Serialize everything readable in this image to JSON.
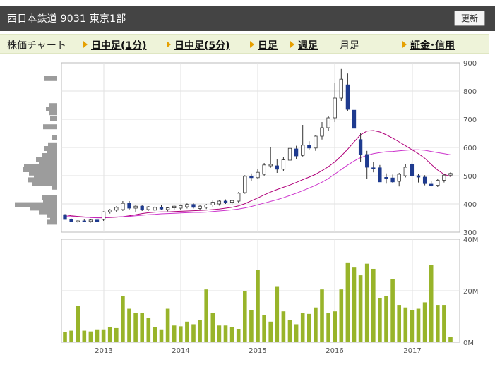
{
  "header": {
    "title": "西日本鉄道  9031  東京1部",
    "refresh_label": "更新"
  },
  "nav": {
    "chart_label": "株価チャート",
    "tabs": [
      {
        "label": "日中足(1分)"
      },
      {
        "label": "日中足(5分)"
      },
      {
        "label": "日足"
      },
      {
        "label": "週足"
      },
      {
        "label": "月足"
      }
    ],
    "margin_label": "証金･信用"
  },
  "chart_data": {
    "type": "candlestick",
    "price_axis": {
      "ticks": [
        300,
        400,
        500,
        600,
        700,
        800,
        900
      ],
      "range": [
        300,
        900
      ]
    },
    "volume_axis": {
      "ticks": [
        "0M",
        "20M",
        "40M"
      ],
      "range": [
        0,
        40
      ]
    },
    "x_labels": [
      "2013",
      "2014",
      "2015",
      "2016",
      "2017"
    ],
    "candle_color_up": "#ffffff",
    "candle_color_down": "#1f3b8f",
    "ma_color": "#b0007a",
    "volume_color": "#98b42a",
    "candles": [
      {
        "o": 362,
        "h": 364,
        "l": 345,
        "c": 345
      },
      {
        "o": 345,
        "h": 348,
        "l": 335,
        "c": 337
      },
      {
        "o": 337,
        "h": 342,
        "l": 334,
        "c": 340
      },
      {
        "o": 340,
        "h": 346,
        "l": 336,
        "c": 338
      },
      {
        "o": 338,
        "h": 345,
        "l": 334,
        "c": 343
      },
      {
        "o": 343,
        "h": 348,
        "l": 336,
        "c": 338
      },
      {
        "o": 345,
        "h": 374,
        "l": 340,
        "c": 372
      },
      {
        "o": 372,
        "h": 382,
        "l": 366,
        "c": 378
      },
      {
        "o": 378,
        "h": 392,
        "l": 372,
        "c": 388
      },
      {
        "o": 380,
        "h": 410,
        "l": 375,
        "c": 402
      },
      {
        "o": 402,
        "h": 410,
        "l": 378,
        "c": 385
      },
      {
        "o": 385,
        "h": 395,
        "l": 372,
        "c": 392
      },
      {
        "o": 392,
        "h": 396,
        "l": 375,
        "c": 380
      },
      {
        "o": 380,
        "h": 392,
        "l": 376,
        "c": 390
      },
      {
        "o": 378,
        "h": 392,
        "l": 374,
        "c": 388
      },
      {
        "o": 388,
        "h": 396,
        "l": 378,
        "c": 382
      },
      {
        "o": 380,
        "h": 390,
        "l": 374,
        "c": 386
      },
      {
        "o": 386,
        "h": 394,
        "l": 380,
        "c": 392
      },
      {
        "o": 385,
        "h": 398,
        "l": 380,
        "c": 394
      },
      {
        "o": 390,
        "h": 402,
        "l": 384,
        "c": 398
      },
      {
        "o": 398,
        "h": 402,
        "l": 384,
        "c": 388
      },
      {
        "o": 384,
        "h": 396,
        "l": 378,
        "c": 392
      },
      {
        "o": 388,
        "h": 400,
        "l": 382,
        "c": 396
      },
      {
        "o": 396,
        "h": 412,
        "l": 390,
        "c": 406
      },
      {
        "o": 400,
        "h": 414,
        "l": 394,
        "c": 410
      },
      {
        "o": 410,
        "h": 416,
        "l": 400,
        "c": 406
      },
      {
        "o": 406,
        "h": 414,
        "l": 398,
        "c": 412
      },
      {
        "o": 410,
        "h": 442,
        "l": 405,
        "c": 438
      },
      {
        "o": 440,
        "h": 502,
        "l": 436,
        "c": 498
      },
      {
        "o": 498,
        "h": 508,
        "l": 480,
        "c": 493
      },
      {
        "o": 493,
        "h": 525,
        "l": 488,
        "c": 512
      },
      {
        "o": 505,
        "h": 545,
        "l": 498,
        "c": 538
      },
      {
        "o": 535,
        "h": 600,
        "l": 528,
        "c": 540
      },
      {
        "o": 535,
        "h": 560,
        "l": 510,
        "c": 523
      },
      {
        "o": 523,
        "h": 565,
        "l": 516,
        "c": 556
      },
      {
        "o": 555,
        "h": 608,
        "l": 545,
        "c": 597
      },
      {
        "o": 595,
        "h": 606,
        "l": 558,
        "c": 570
      },
      {
        "o": 572,
        "h": 680,
        "l": 568,
        "c": 608
      },
      {
        "o": 608,
        "h": 622,
        "l": 592,
        "c": 598
      },
      {
        "o": 598,
        "h": 645,
        "l": 588,
        "c": 640
      },
      {
        "o": 640,
        "h": 690,
        "l": 628,
        "c": 670
      },
      {
        "o": 670,
        "h": 710,
        "l": 660,
        "c": 705
      },
      {
        "o": 705,
        "h": 830,
        "l": 690,
        "c": 775
      },
      {
        "o": 775,
        "h": 878,
        "l": 765,
        "c": 842
      },
      {
        "o": 822,
        "h": 862,
        "l": 728,
        "c": 735
      },
      {
        "o": 732,
        "h": 742,
        "l": 650,
        "c": 668
      },
      {
        "o": 628,
        "h": 650,
        "l": 548,
        "c": 574
      },
      {
        "o": 575,
        "h": 588,
        "l": 488,
        "c": 530
      },
      {
        "o": 528,
        "h": 548,
        "l": 512,
        "c": 527
      },
      {
        "o": 528,
        "h": 538,
        "l": 478,
        "c": 478
      },
      {
        "o": 494,
        "h": 508,
        "l": 472,
        "c": 490
      },
      {
        "o": 492,
        "h": 504,
        "l": 474,
        "c": 478
      },
      {
        "o": 480,
        "h": 510,
        "l": 462,
        "c": 505
      },
      {
        "o": 500,
        "h": 540,
        "l": 494,
        "c": 530
      },
      {
        "o": 540,
        "h": 546,
        "l": 496,
        "c": 500
      },
      {
        "o": 500,
        "h": 505,
        "l": 476,
        "c": 495
      },
      {
        "o": 495,
        "h": 502,
        "l": 466,
        "c": 472
      },
      {
        "o": 470,
        "h": 480,
        "l": 462,
        "c": 465
      },
      {
        "o": 466,
        "h": 488,
        "l": 460,
        "c": 484
      },
      {
        "o": 484,
        "h": 506,
        "l": 476,
        "c": 502
      },
      {
        "o": 502,
        "h": 512,
        "l": 496,
        "c": 508
      }
    ],
    "ma_short": [
      362,
      358,
      356,
      354,
      352,
      351,
      351,
      352,
      353,
      355,
      358,
      362,
      366,
      369,
      371,
      372,
      372,
      373,
      374,
      375,
      376,
      377,
      378,
      380,
      382,
      385,
      388,
      393,
      401,
      411,
      421,
      432,
      442,
      451,
      459,
      467,
      476,
      486,
      495,
      505,
      518,
      532,
      549,
      570,
      594,
      620,
      645,
      658,
      660,
      655,
      645,
      633,
      620,
      606,
      592,
      578,
      562,
      540,
      520,
      505,
      497
    ],
    "ma_long": [
      356,
      355,
      354,
      353,
      352,
      352,
      352,
      353,
      354,
      355,
      356,
      358,
      360,
      362,
      363,
      365,
      366,
      367,
      368,
      369,
      370,
      370,
      371,
      373,
      375,
      377,
      379,
      382,
      386,
      391,
      397,
      403,
      409,
      415,
      422,
      430,
      438,
      447,
      456,
      466,
      477,
      490,
      506,
      522,
      538,
      552,
      564,
      572,
      578,
      582,
      585,
      586,
      588,
      590,
      592,
      592,
      590,
      586,
      582,
      578,
      574
    ],
    "volumes": [
      4,
      4.5,
      14,
      4.5,
      4.2,
      5,
      5,
      6,
      5.5,
      18,
      13,
      11.5,
      11.5,
      9.5,
      6,
      5,
      13,
      6.5,
      6.2,
      8,
      7,
      8.5,
      20.5,
      11.5,
      6.5,
      6.5,
      5.8,
      5.2,
      20,
      12.5,
      28,
      10.5,
      8,
      21.5,
      12,
      8.5,
      7,
      11.5,
      11,
      13.5,
      20.5,
      11.5,
      12,
      20.5,
      31,
      29,
      26,
      30.5,
      28.5,
      17,
      18,
      24.5,
      14.5,
      13.5,
      12.5,
      13,
      15.5,
      30,
      14.5,
      14.5,
      2
    ],
    "volume_profile": [
      {
        "price": 843,
        "width": 18
      },
      {
        "price": 747,
        "width": 12
      },
      {
        "price": 735,
        "width": 16
      },
      {
        "price": 722,
        "width": 12
      },
      {
        "price": 700,
        "width": 10
      },
      {
        "price": 672,
        "width": 20
      },
      {
        "price": 634,
        "width": 8
      },
      {
        "price": 608,
        "width": 13
      },
      {
        "price": 595,
        "width": 19
      },
      {
        "price": 582,
        "width": 14
      },
      {
        "price": 570,
        "width": 22
      },
      {
        "price": 557,
        "width": 30
      },
      {
        "price": 545,
        "width": 26
      },
      {
        "price": 532,
        "width": 47
      },
      {
        "price": 520,
        "width": 48
      },
      {
        "price": 508,
        "width": 40
      },
      {
        "price": 496,
        "width": 33
      },
      {
        "price": 484,
        "width": 42
      },
      {
        "price": 471,
        "width": 36
      },
      {
        "price": 458,
        "width": 8
      },
      {
        "price": 421,
        "width": 22
      },
      {
        "price": 408,
        "width": 20
      },
      {
        "price": 396,
        "width": 60
      },
      {
        "price": 384,
        "width": 38
      },
      {
        "price": 371,
        "width": 26
      },
      {
        "price": 358,
        "width": 14
      },
      {
        "price": 346,
        "width": 10
      },
      {
        "price": 334,
        "width": 14
      }
    ]
  }
}
